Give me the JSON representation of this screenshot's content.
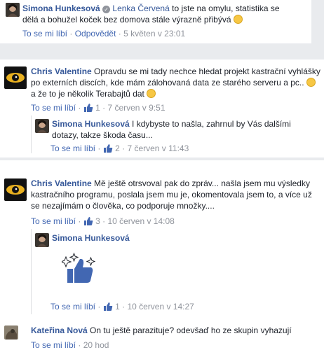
{
  "comment1": {
    "author": "Simona Hunkesová",
    "mention": "Lenka Červená",
    "line1": "to jste na omylu, statistika se",
    "line2": "dělá a bohužel koček bez domova stále výrazně přibývá",
    "like_label": "To se mi líbí",
    "reply_label": "Odpovědět",
    "time": "5 květen v 23:01"
  },
  "comment2": {
    "author": "Chris Valentine",
    "line1": "Opravdu se mi tady nechce hledat projekt kastrační vyhlášky",
    "line2": "po externích discích, kde mám zálohovaná data ze starého serveru a pc..",
    "line3": "a že to je několik Terabajtů dat",
    "like_label": "To se mi líbí",
    "like_count": "1",
    "time": "7 červen v 9:51",
    "reply": {
      "author": "Simona Hunkesová",
      "line1": "I kdybyste to našla, zahrnul by Vás dalšími",
      "line2": "dotazy, takze škoda času...",
      "like_label": "To se mi líbí",
      "like_count": "2",
      "time": "7 červen v 11:43"
    }
  },
  "comment3": {
    "author": "Chris Valentine",
    "line1": "Mě ještě otrsvoval pak do zpráv... našla jsem mu výsledky",
    "line2": "kastračního programu, poslala jsem mu je, okomentovala jsem to, a více už",
    "line3": "se nezajímám o člověka, co podporuje množky....",
    "like_label": "To se mi líbí",
    "like_count": "3",
    "time": "10 červen v 14:08",
    "reply": {
      "author": "Simona Hunkesová",
      "like_label": "To se mi líbí",
      "like_count": "1",
      "time": "10 červen v 14:27"
    }
  },
  "comment4": {
    "author": "Kateřina Nová",
    "text": "On tu ještě parazituje? odevšaď ho ze skupin vyhazují",
    "like_label": "To se mi líbí",
    "time": "20 hod"
  },
  "colors": {
    "link": "#365899",
    "meta": "#90949c",
    "like_blue": "#4267b2",
    "background": "#e9ebee"
  }
}
